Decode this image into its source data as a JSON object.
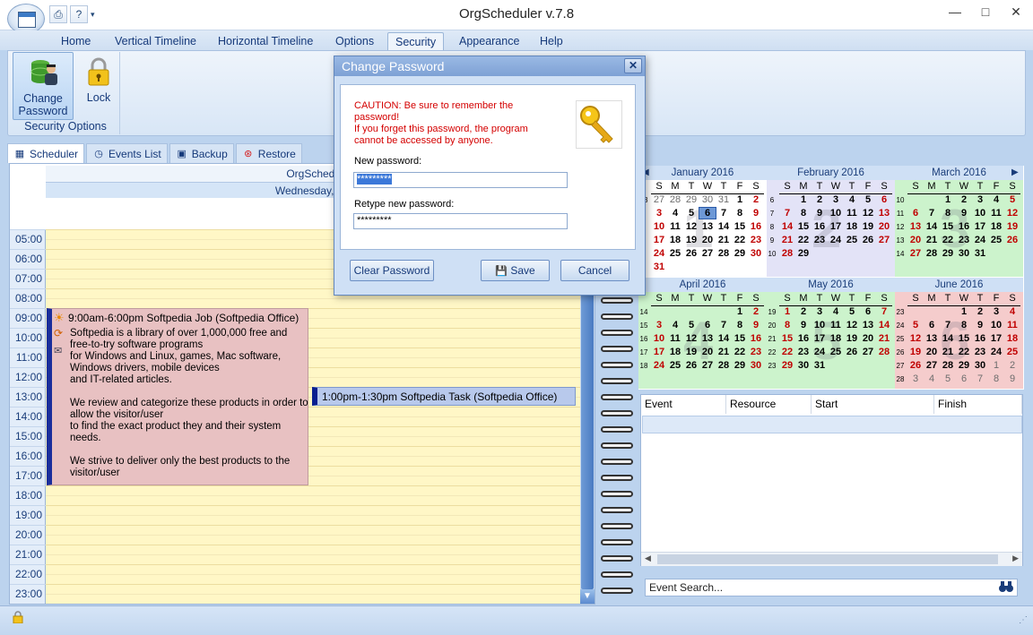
{
  "window": {
    "title": "OrgScheduler v.7.8",
    "minimize": "—",
    "maximize": "□",
    "close": "✕"
  },
  "ribbon": {
    "tabs": [
      "Home",
      "Vertical Timeline",
      "Horizontal Timeline",
      "Options",
      "Security",
      "Appearance",
      "Help"
    ],
    "active_tab": "Security",
    "change_password_label": "Change Password",
    "lock_label": "Lock",
    "group_label": "Security Options"
  },
  "view_tabs": {
    "scheduler": "Scheduler",
    "events_list": "Events List",
    "backup": "Backup",
    "restore": "Restore"
  },
  "scheduler": {
    "header_title": "OrgSchedul",
    "header_date": "Wednesday, Jan",
    "times": [
      "05:00",
      "06:00",
      "07:00",
      "08:00",
      "09:00",
      "10:00",
      "11:00",
      "12:00",
      "13:00",
      "14:00",
      "15:00",
      "16:00",
      "17:00",
      "18:00",
      "19:00",
      "20:00",
      "21:00",
      "22:00",
      "23:00"
    ],
    "appointment1_title": "9:00am-6:00pm Softpedia Job (Softpedia Office)",
    "appointment1_body": "Softpedia is a library of over 1,000,000 free and free-to-try software programs\nfor Windows and Linux, games, Mac software, Windows drivers, mobile devices\nand IT-related articles.\n\nWe review and categorize these products in order to allow the visitor/user\nto find the exact product they and their system needs.\n\nWe strive to deliver only the best products to the visitor/user",
    "appointment2_title": "1:00pm-1:30pm Softpedia Task (Softpedia Office)"
  },
  "calendar": {
    "dow": [
      "S",
      "M",
      "T",
      "W",
      "T",
      "F",
      "S"
    ],
    "months": [
      {
        "name": "January 2016",
        "big": "1",
        "bg": "#ffffff",
        "weeks": [
          "53",
          "1",
          "2",
          "3",
          "4",
          "5",
          "6"
        ],
        "rows": [
          [
            "27",
            "28",
            "29",
            "30",
            "31",
            "1",
            "2"
          ],
          [
            "3",
            "4",
            "5",
            "6",
            "7",
            "8",
            "9"
          ],
          [
            "10",
            "11",
            "12",
            "13",
            "14",
            "15",
            "16"
          ],
          [
            "17",
            "18",
            "19",
            "20",
            "21",
            "22",
            "23"
          ],
          [
            "24",
            "25",
            "26",
            "27",
            "28",
            "29",
            "30"
          ],
          [
            "31",
            "",
            "",
            "",
            "",
            "",
            ""
          ]
        ]
      },
      {
        "name": "February 2016",
        "big": "2",
        "bg": "#e3e3f7",
        "weeks": [
          "6",
          "7",
          "8",
          "9",
          "10"
        ],
        "rows": [
          [
            "",
            "1",
            "2",
            "3",
            "4",
            "5",
            "6"
          ],
          [
            "7",
            "8",
            "9",
            "10",
            "11",
            "12",
            "13"
          ],
          [
            "14",
            "15",
            "16",
            "17",
            "18",
            "19",
            "20"
          ],
          [
            "21",
            "22",
            "23",
            "24",
            "25",
            "26",
            "27"
          ],
          [
            "28",
            "29",
            "",
            "",
            "",
            "",
            ""
          ]
        ]
      },
      {
        "name": "March 2016",
        "big": "3",
        "bg": "#ccf3cc",
        "weeks": [
          "10",
          "11",
          "12",
          "13",
          "14"
        ],
        "rows": [
          [
            "",
            "",
            "1",
            "2",
            "3",
            "4",
            "5"
          ],
          [
            "6",
            "7",
            "8",
            "9",
            "10",
            "11",
            "12"
          ],
          [
            "13",
            "14",
            "15",
            "16",
            "17",
            "18",
            "19"
          ],
          [
            "20",
            "21",
            "22",
            "23",
            "24",
            "25",
            "26"
          ],
          [
            "27",
            "28",
            "29",
            "30",
            "31",
            "",
            ""
          ]
        ]
      },
      {
        "name": "April 2016",
        "big": "4",
        "bg": "#ccf3cc",
        "weeks": [
          "14",
          "15",
          "16",
          "17",
          "18"
        ],
        "rows": [
          [
            "",
            "",
            "",
            "",
            "",
            "1",
            "2"
          ],
          [
            "3",
            "4",
            "5",
            "6",
            "7",
            "8",
            "9"
          ],
          [
            "10",
            "11",
            "12",
            "13",
            "14",
            "15",
            "16"
          ],
          [
            "17",
            "18",
            "19",
            "20",
            "21",
            "22",
            "23"
          ],
          [
            "24",
            "25",
            "26",
            "27",
            "28",
            "29",
            "30"
          ]
        ]
      },
      {
        "name": "May 2016",
        "big": "5",
        "bg": "#ccf3cc",
        "weeks": [
          "19",
          "20",
          "21",
          "22",
          "23"
        ],
        "rows": [
          [
            "1",
            "2",
            "3",
            "4",
            "5",
            "6",
            "7"
          ],
          [
            "8",
            "9",
            "10",
            "11",
            "12",
            "13",
            "14"
          ],
          [
            "15",
            "16",
            "17",
            "18",
            "19",
            "20",
            "21"
          ],
          [
            "22",
            "23",
            "24",
            "25",
            "26",
            "27",
            "28"
          ],
          [
            "29",
            "30",
            "31",
            "",
            "",
            "",
            ""
          ]
        ]
      },
      {
        "name": "June 2016",
        "big": "6",
        "bg": "#f5cccc",
        "weeks": [
          "23",
          "24",
          "25",
          "26",
          "27",
          "28"
        ],
        "rows": [
          [
            "",
            "",
            "",
            "1",
            "2",
            "3",
            "4"
          ],
          [
            "5",
            "6",
            "7",
            "8",
            "9",
            "10",
            "11"
          ],
          [
            "12",
            "13",
            "14",
            "15",
            "16",
            "17",
            "18"
          ],
          [
            "19",
            "20",
            "21",
            "22",
            "23",
            "24",
            "25"
          ],
          [
            "26",
            "27",
            "28",
            "29",
            "30",
            "1",
            "2"
          ],
          [
            "3",
            "4",
            "5",
            "6",
            "7",
            "8",
            "9"
          ]
        ]
      }
    ]
  },
  "event_list": {
    "columns": [
      "Event",
      "Resource",
      "Start",
      "Finish"
    ],
    "search_placeholder": "Event Search..."
  },
  "dialog": {
    "title": "Change Password",
    "caution": "CAUTION: Be sure to remember the\npassword!\nIf you forget this password, the program\ncannot be accessed by anyone.",
    "new_password_label": "New password:",
    "new_password_value": "*********",
    "retype_label": "Retype new password:",
    "retype_value": "*********",
    "clear_button": "Clear Password",
    "save_button": "Save",
    "cancel_button": "Cancel"
  },
  "colors": {
    "accent": "#3b78d9",
    "caution": "#d40000",
    "appointment": "#e8c1c2",
    "day_bg": "#fff7c6"
  }
}
